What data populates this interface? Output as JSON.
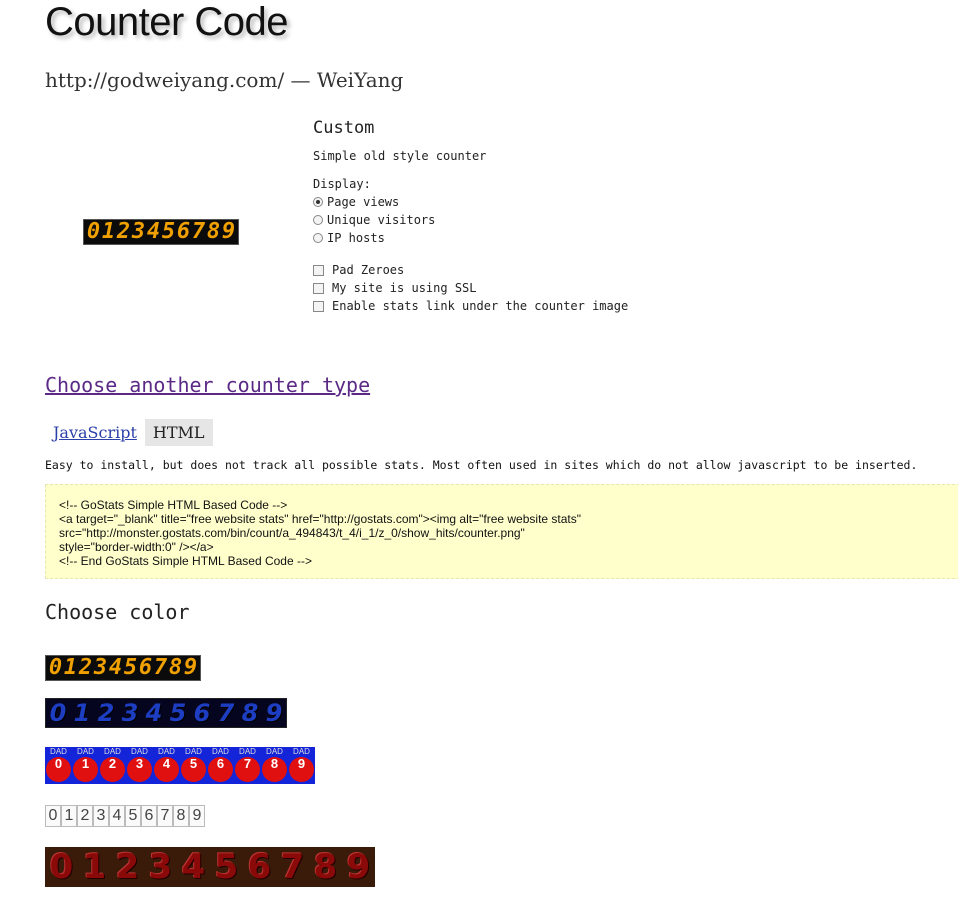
{
  "page": {
    "title": "Counter Code",
    "site_line": "http://godweiyang.com/ — WeiYang"
  },
  "options": {
    "heading": "Custom",
    "subtitle": "Simple old style counter",
    "display_label": "Display:",
    "radios": [
      {
        "label": "Page views",
        "checked": true
      },
      {
        "label": "Unique visitors",
        "checked": false
      },
      {
        "label": "IP hosts",
        "checked": false
      }
    ],
    "checkboxes": [
      {
        "label": "Pad Zeroes",
        "checked": false
      },
      {
        "label": "My site is using SSL",
        "checked": false
      },
      {
        "label": "Enable stats link under the counter image",
        "checked": false
      }
    ]
  },
  "links": {
    "choose_another": "Choose another counter type"
  },
  "tabs": {
    "javascript": "JavaScript",
    "html": "HTML",
    "active": "HTML"
  },
  "description": "Easy to install, but does not track all possible stats. Most often used in sites which do not allow javascript to be inserted.",
  "code": {
    "lines": [
      "<!-- GoStats Simple HTML Based Code -->",
      "<a target=\"_blank\" title=\"free website stats\" href=\"http://gostats.com\"><img alt=\"free website stats\"",
      "src=\"http://monster.gostats.com/bin/count/a_494843/t_4/i_1/z_0/show_hits/counter.png\"",
      "style=\"border-width:0\" /></a>",
      "<!-- End GoStats Simple HTML Based Code -->"
    ]
  },
  "colors": {
    "heading": "Choose color",
    "digits": "0123456789",
    "dad_label": "DAD",
    "accent_orange": "#f0a000",
    "accent_blue": "#1424d8",
    "accent_red": "#e01010",
    "code_bg": "#ffffcc",
    "link_purple": "#5b2a86"
  }
}
